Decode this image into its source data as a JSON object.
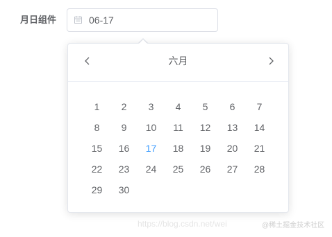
{
  "form": {
    "label": "月日组件",
    "input_value": "06-17",
    "icon": "calendar-icon"
  },
  "picker": {
    "month_title": "六月",
    "prev_icon": "chevron-left-icon",
    "next_icon": "chevron-right-icon",
    "today": 17,
    "weeks": [
      [
        "1",
        "2",
        "3",
        "4",
        "5",
        "6",
        "7"
      ],
      [
        "8",
        "9",
        "10",
        "11",
        "12",
        "13",
        "14"
      ],
      [
        "15",
        "16",
        "17",
        "18",
        "19",
        "20",
        "21"
      ],
      [
        "22",
        "23",
        "24",
        "25",
        "26",
        "27",
        "28"
      ],
      [
        "29",
        "30"
      ]
    ]
  },
  "watermark": {
    "url": "https://blog.csdn.net/wei",
    "brand": "@稀土掘金技术社区"
  },
  "colors": {
    "accent": "#409eff",
    "text": "#606266",
    "border": "#dcdfe6"
  }
}
